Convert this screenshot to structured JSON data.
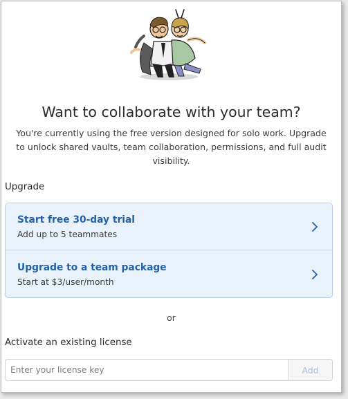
{
  "header": {
    "title": "Want to collaborate with your team?",
    "description": "You're currently using the free version designed for solo work. Upgrade to unlock shared vaults, team collaboration, permissions, and full audit visibility."
  },
  "upgrade": {
    "section_label": "Upgrade",
    "options": [
      {
        "title": "Start free 30-day trial",
        "subtitle": "Add up to 5 teammates",
        "icon": "chevron-right-icon"
      },
      {
        "title": "Upgrade to a team package",
        "subtitle": "Start at $3/user/month",
        "icon": "chevron-right-icon"
      }
    ]
  },
  "divider": {
    "text": "or"
  },
  "license": {
    "section_label": "Activate an existing license",
    "input_value": "",
    "input_placeholder": "Enter your license key",
    "add_label": "Add"
  },
  "colors": {
    "accent": "#2462a8",
    "option_background": "#e9f1fb",
    "option_border": "#b8cbe4",
    "add_disabled_text": "#a9bfda"
  }
}
